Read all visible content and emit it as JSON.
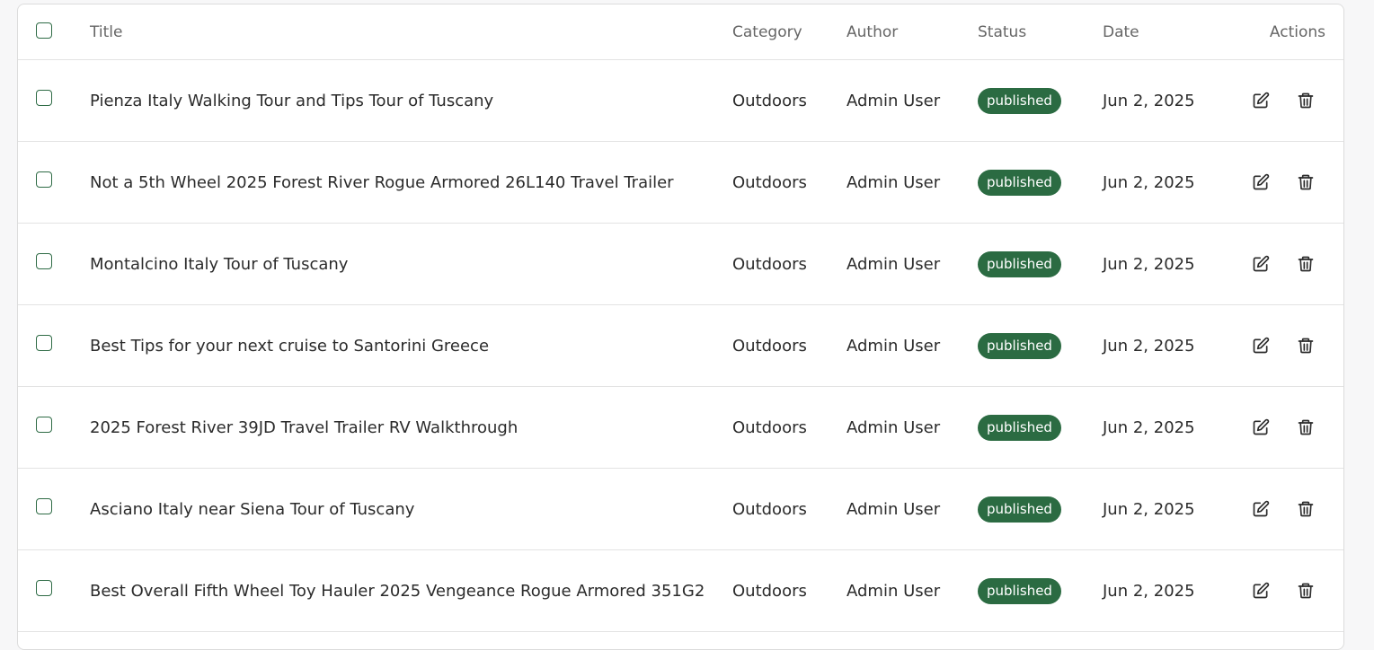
{
  "table": {
    "headers": {
      "title": "Title",
      "category": "Category",
      "author": "Author",
      "status": "Status",
      "date": "Date",
      "actions": "Actions"
    },
    "rows": [
      {
        "title": "Pienza Italy Walking Tour and Tips Tour of Tuscany",
        "category": "Outdoors",
        "author": "Admin User",
        "status": "published",
        "date": "Jun 2, 2025"
      },
      {
        "title": "Not a 5th Wheel 2025 Forest River Rogue Armored 26L140 Travel Trailer",
        "category": "Outdoors",
        "author": "Admin User",
        "status": "published",
        "date": "Jun 2, 2025"
      },
      {
        "title": "Montalcino Italy Tour of Tuscany",
        "category": "Outdoors",
        "author": "Admin User",
        "status": "published",
        "date": "Jun 2, 2025"
      },
      {
        "title": "Best Tips for your next cruise to Santorini Greece",
        "category": "Outdoors",
        "author": "Admin User",
        "status": "published",
        "date": "Jun 2, 2025"
      },
      {
        "title": "2025 Forest River 39JD Travel Trailer RV Walkthrough",
        "category": "Outdoors",
        "author": "Admin User",
        "status": "published",
        "date": "Jun 2, 2025"
      },
      {
        "title": "Asciano Italy near Siena Tour of Tuscany",
        "category": "Outdoors",
        "author": "Admin User",
        "status": "published",
        "date": "Jun 2, 2025"
      },
      {
        "title": "Best Overall Fifth Wheel Toy Hauler 2025 Vengeance Rogue Armored 351G2",
        "category": "Outdoors",
        "author": "Admin User",
        "status": "published",
        "date": "Jun 2, 2025"
      }
    ],
    "icons": {
      "edit": "edit-icon",
      "delete": "trash-icon"
    },
    "colors": {
      "accent": "#2b6b42",
      "checkbox_border": "#2e6b45"
    }
  }
}
